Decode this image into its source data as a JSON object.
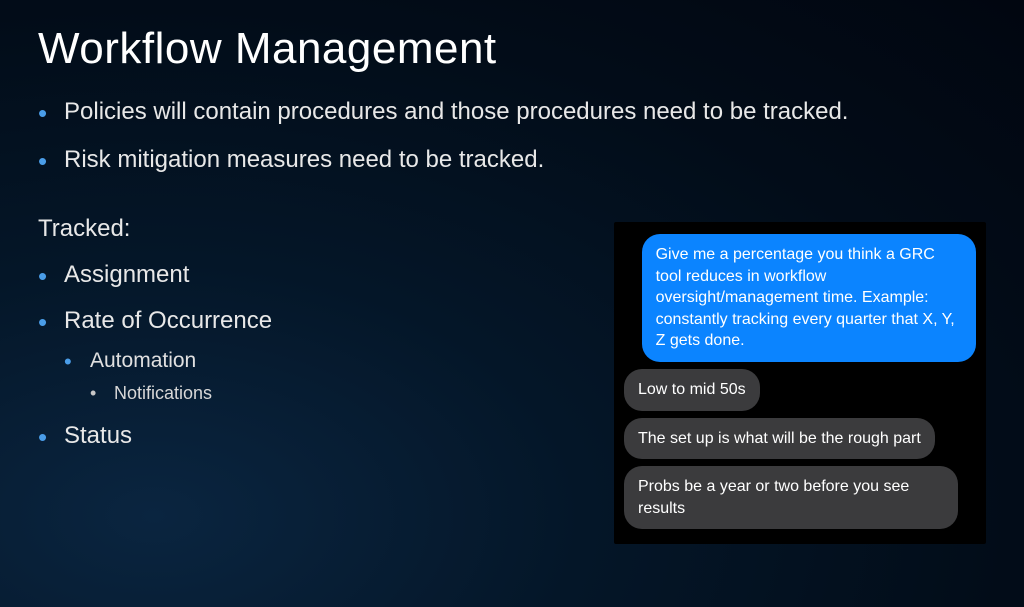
{
  "title": "Workflow Management",
  "main_bullets": [
    "Policies will contain procedures and those procedures need to be tracked.",
    "Risk mitigation measures need to be tracked."
  ],
  "tracked_heading": "Tracked:",
  "tracked_items": {
    "item1": "Assignment",
    "item2": "Rate of Occurrence",
    "item2_sub": "Automation",
    "item2_sub_sub": "Notifications",
    "item3": "Status"
  },
  "chat": {
    "blue": "Give me a percentage you think a GRC tool reduces in workflow oversight/management time. Example: constantly tracking every quarter that X, Y, Z gets done.",
    "gray1": "Low to mid 50s",
    "gray2": "The set up is what will be the rough part",
    "gray3": "Probs be a year or two before you see results"
  }
}
